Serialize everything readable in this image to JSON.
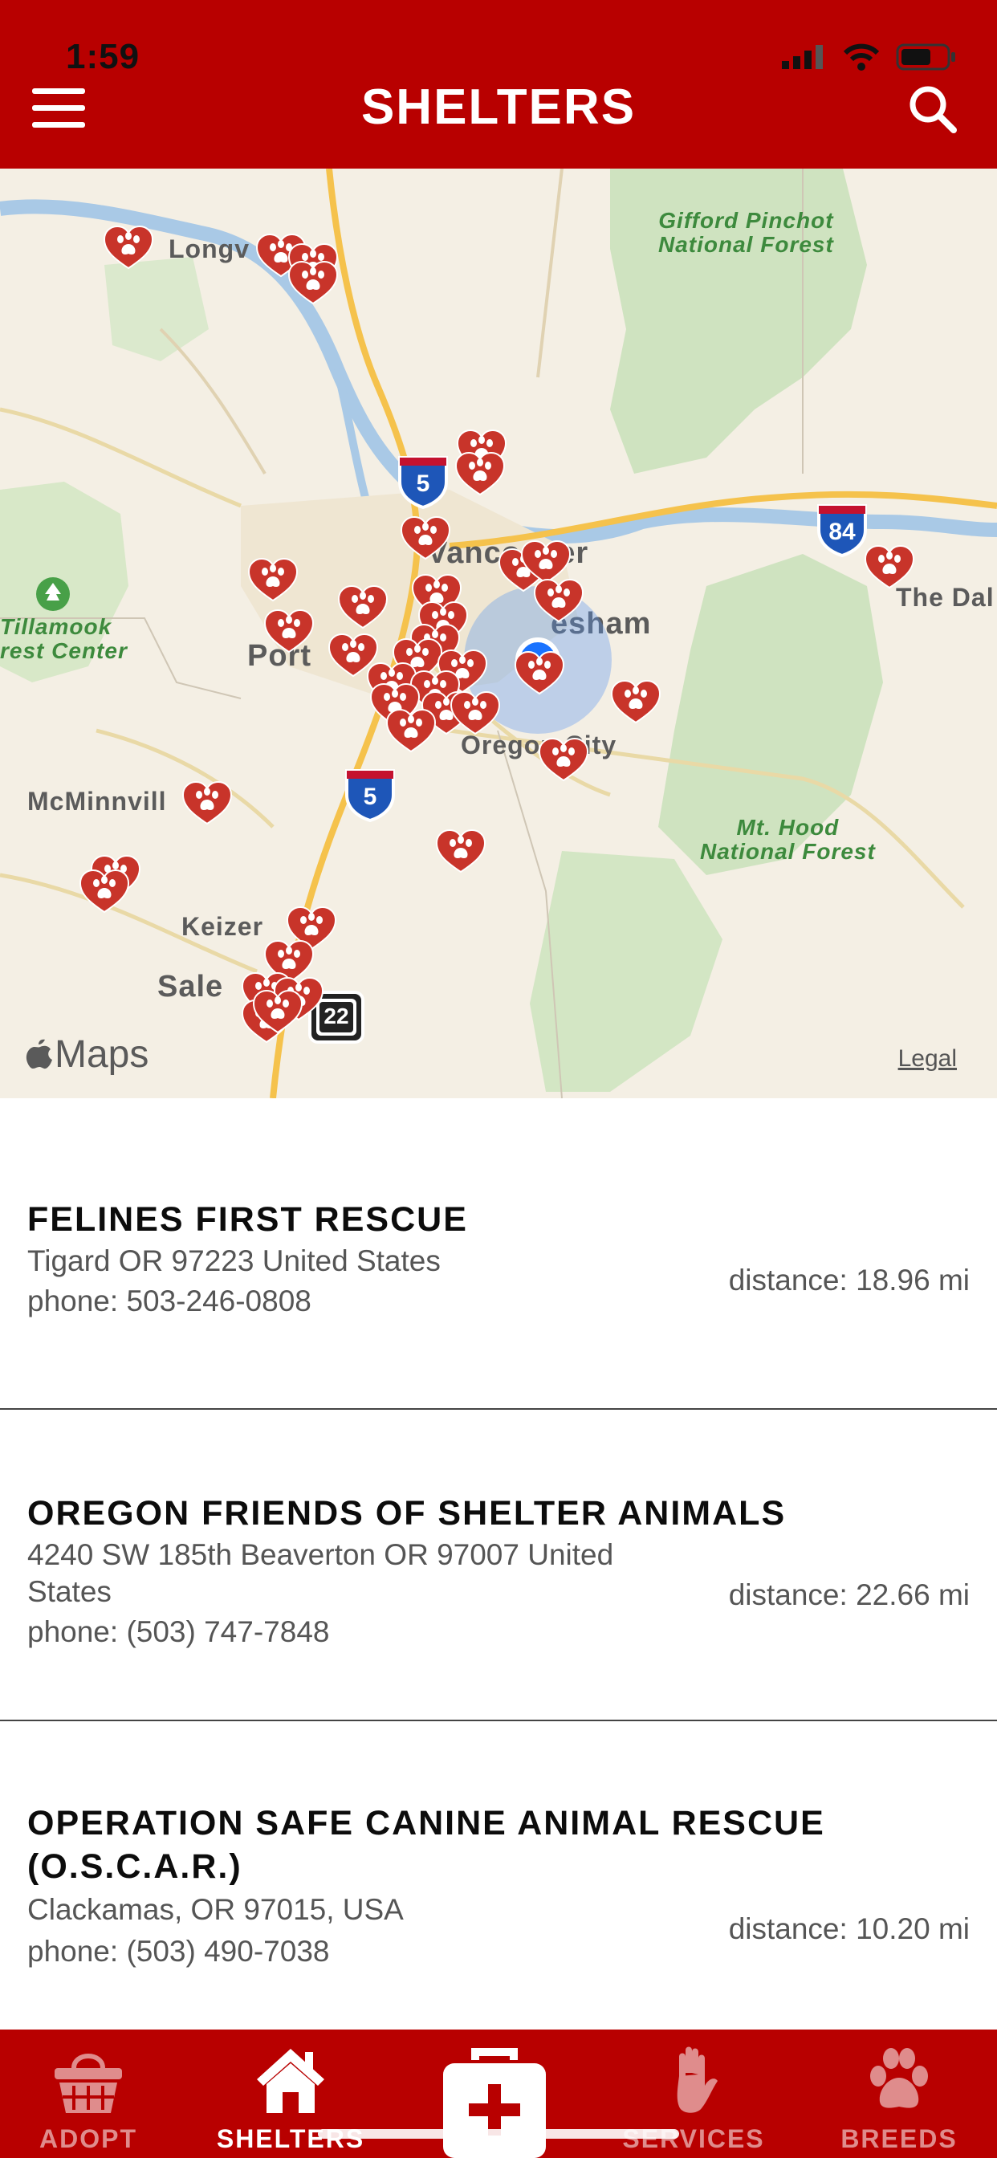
{
  "status": {
    "time": "1:59"
  },
  "header": {
    "title": "SHELTERS",
    "menu_icon": "hamburger-menu-icon",
    "search_icon": "search-icon"
  },
  "map": {
    "labels": {
      "longview": "Longv",
      "vancouver": "Vancouver",
      "portland": "Port",
      "gresham": "esham",
      "oregon_city": "Oregon City",
      "mcminnville": "McMinnvill",
      "keizer": "Keizer",
      "salem": "Sale",
      "the_dalles": "The Dal",
      "tillamook": "Tillamook\nrest Center",
      "gifford": "Gifford Pinchot\nNational Forest",
      "mt_hood": "Mt. Hood\nNational Forest"
    },
    "shields": {
      "i5_north": "5",
      "i5_south": "5",
      "i84": "84",
      "or22": "22"
    },
    "attribution": "Maps",
    "legal": "Legal"
  },
  "shelters": [
    {
      "name": "FELINES FIRST RESCUE",
      "address": " Tigard OR 97223 United States",
      "phone": "phone: 503-246-0808",
      "distance": "distance: 18.96 mi"
    },
    {
      "name": "OREGON FRIENDS OF SHELTER ANIMALS",
      "address": "4240 SW 185th Beaverton OR 97007 United States",
      "phone": "phone: (503) 747-7848",
      "distance": "distance: 22.66 mi"
    },
    {
      "name": "OPERATION SAFE CANINE ANIMAL RESCUE (O.S.C.A.R.)",
      "address": "Clackamas, OR 97015, USA",
      "phone": "phone: (503) 490-7038",
      "distance": "distance: 10.20 mi"
    }
  ],
  "tabbar": {
    "tabs": [
      {
        "label": "ADOPT",
        "icon": "basket-icon"
      },
      {
        "label": "SHELTERS",
        "icon": "house-icon"
      },
      {
        "label": "SERVICES",
        "icon": "hand-icon"
      },
      {
        "label": "BREEDS",
        "icon": "paw-icon"
      }
    ],
    "center_icon": "first-aid-kit-icon",
    "active": "SHELTERS"
  },
  "colors": {
    "brand_red": "#b80000",
    "pin_red": "#c8342a",
    "user_blue": "#1a73ff"
  }
}
